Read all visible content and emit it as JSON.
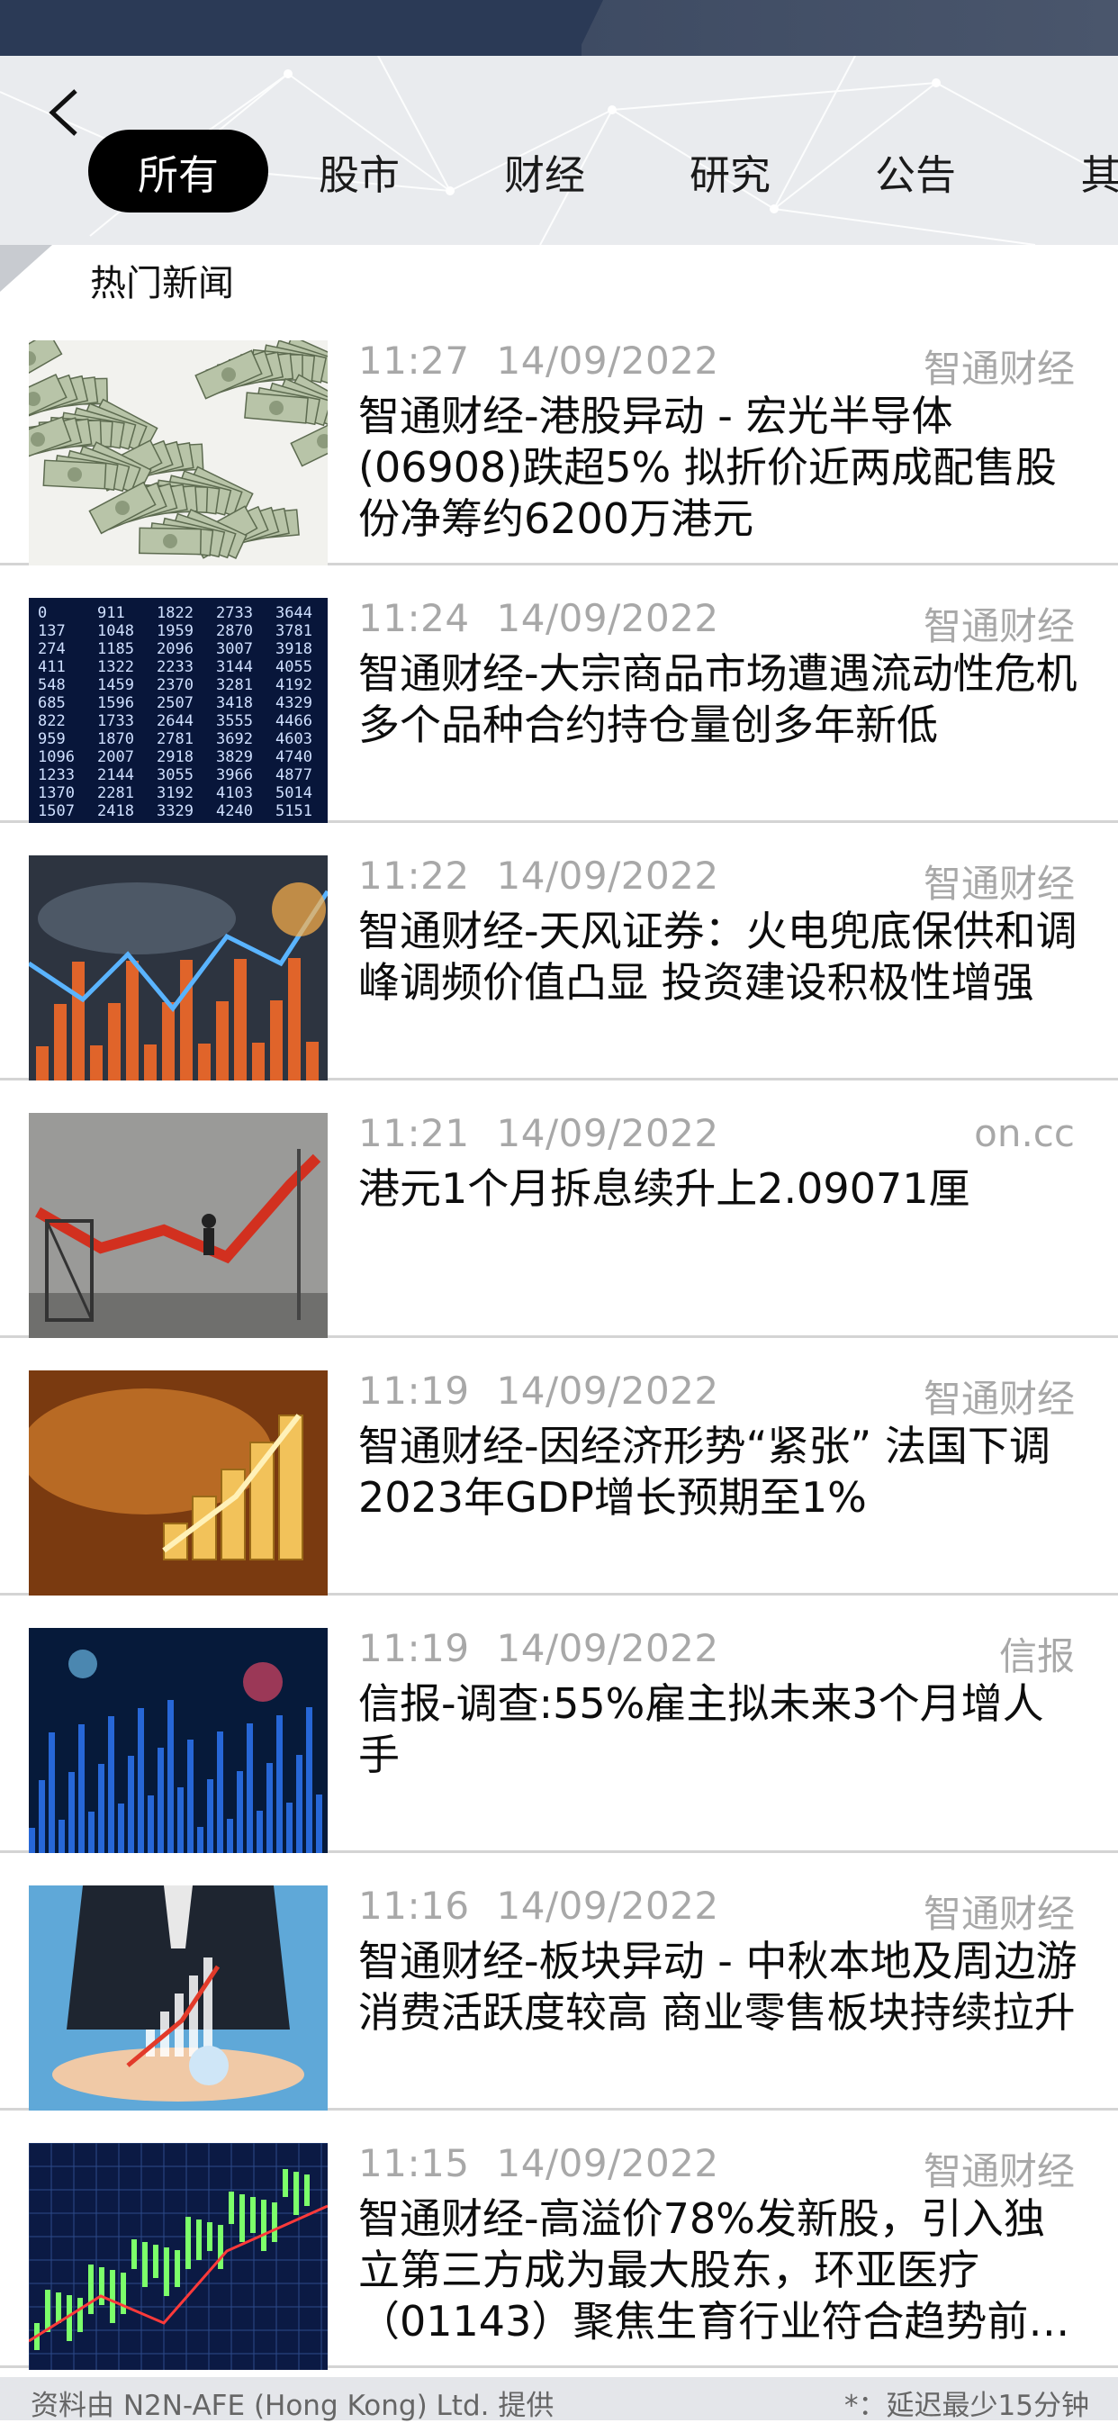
{
  "header": {
    "back_label": "",
    "tabs": [
      {
        "label": "所有",
        "active": true
      },
      {
        "label": "股市",
        "active": false
      },
      {
        "label": "财经",
        "active": false
      },
      {
        "label": "研究",
        "active": false
      },
      {
        "label": "公告",
        "active": false
      },
      {
        "label": "其",
        "active": false
      }
    ]
  },
  "section": {
    "title": "热门新闻"
  },
  "news": [
    {
      "time": "11:27",
      "date": "14/09/2022",
      "source": "智通财经",
      "headline": "智通财经-港股异动 - 宏光半导体(06908)跌超5% 拟折价近两成配售股份净筹约6200万港元",
      "thumb": "money-pile"
    },
    {
      "time": "11:24",
      "date": "14/09/2022",
      "source": "智通财经",
      "headline": "智通财经-大宗商品市场遭遇流动性危机 多个品种合约持仓量创多年新低",
      "thumb": "stock-board"
    },
    {
      "time": "11:22",
      "date": "14/09/2022",
      "source": "智通财经",
      "headline": "智通财经-天风证券：火电兜底保供和调峰调频价值凸显 投资建设积极性增强",
      "thumb": "bar-chart-map"
    },
    {
      "time": "11:21",
      "date": "14/09/2022",
      "source": "on.cc",
      "headline": "港元1个月拆息续升上2.09071厘",
      "thumb": "climbing-arrow"
    },
    {
      "time": "11:19",
      "date": "14/09/2022",
      "source": "智通财经",
      "headline": "智通财经-因经济形势“紧张” 法国下调2023年GDP增长预期至1%",
      "thumb": "gold-bars"
    },
    {
      "time": "11:19",
      "date": "14/09/2022",
      "source": "信报",
      "headline": "信报-调查:55%雇主拟未来3个月增人手",
      "thumb": "blue-chart"
    },
    {
      "time": "11:16",
      "date": "14/09/2022",
      "source": "智通财经",
      "headline": "智通财经-板块异动 - 中秋本地及周边游消费活跃度较高 商业零售板块持续拉升",
      "thumb": "businessman"
    },
    {
      "time": "11:15",
      "date": "14/09/2022",
      "source": "智通财经",
      "headline": "智通财经-高溢价78%发新股，引入独立第三方成为最大股东，环亚医疗（01143）聚焦生育行业符合趋势前…",
      "thumb": "candlestick"
    }
  ],
  "footer": {
    "provider": "资料由 N2N-AFE (Hong Kong) Ltd. 提供",
    "delay_note": "*：延迟最少15分钟"
  },
  "colors": {
    "accent": "#000000",
    "meta_text": "#a8a8a8",
    "status_bar": "#2b3a56"
  }
}
